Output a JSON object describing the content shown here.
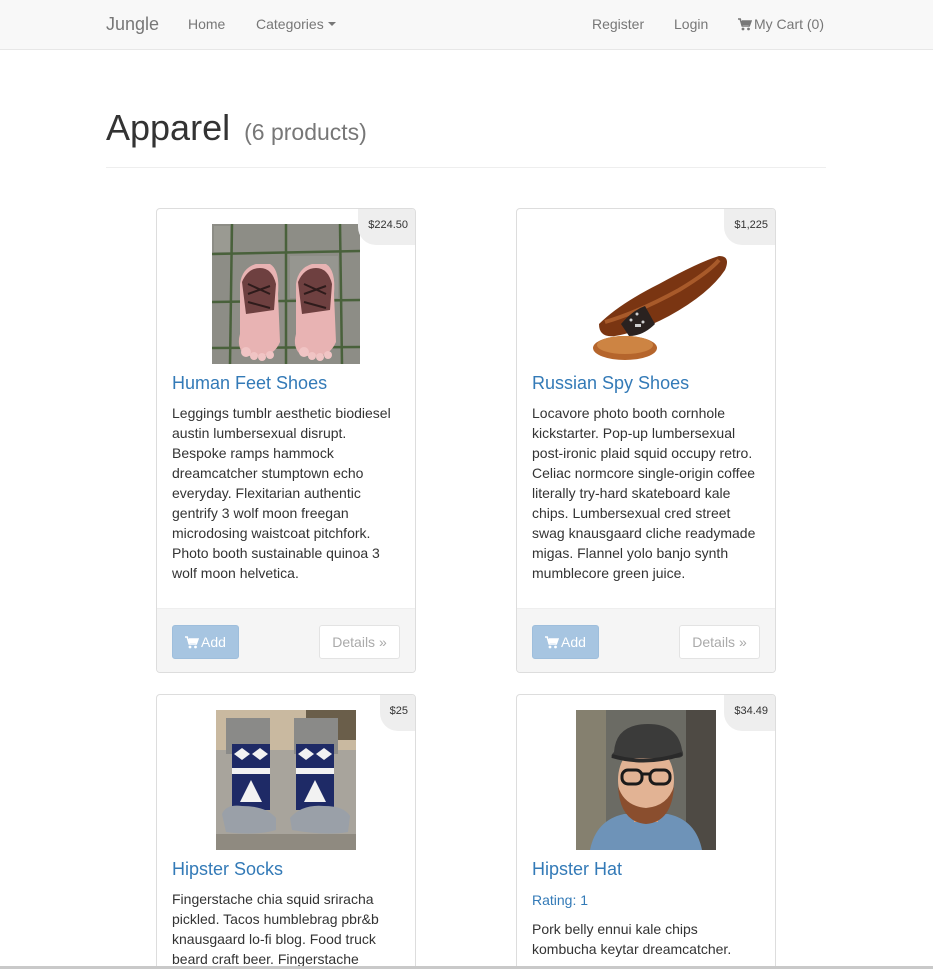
{
  "navbar": {
    "brand": "Jungle",
    "home": "Home",
    "categories": "Categories",
    "register": "Register",
    "login": "Login",
    "cart": "My Cart (0)"
  },
  "page": {
    "title": "Apparel",
    "count": "(6 products)"
  },
  "products": [
    {
      "name": "Human Feet Shoes",
      "price": "$224.50",
      "description": "Leggings tumblr aesthetic biodiesel austin lumbersexual disrupt. Bespoke ramps hammock dreamcatcher stumptown echo everyday. Flexitarian authentic gentrify 3 wolf moon freegan microdosing waistcoat pitchfork. Photo booth sustainable quinoa 3 wolf moon helvetica.",
      "add_label": "Add",
      "details_label": "Details »"
    },
    {
      "name": "Russian Spy Shoes",
      "price": "$1,225",
      "description": "Locavore photo booth cornhole kickstarter. Pop-up lumbersexual post-ironic plaid squid occupy retro. Celiac normcore single-origin coffee literally try-hard skateboard kale chips. Lumbersexual cred street swag knausgaard cliche readymade migas. Flannel yolo banjo synth mumblecore green juice.",
      "add_label": "Add",
      "details_label": "Details »"
    },
    {
      "name": "Hipster Socks",
      "price": "$25",
      "description": "Fingerstache chia squid sriracha pickled. Tacos humblebrag pbr&b knausgaard lo-fi blog. Food truck beard craft beer. Fingerstache"
    },
    {
      "name": "Hipster Hat",
      "price": "$34.49",
      "rating": "Rating: 1",
      "description": "Pork belly ennui kale chips kombucha keytar dreamcatcher."
    }
  ]
}
